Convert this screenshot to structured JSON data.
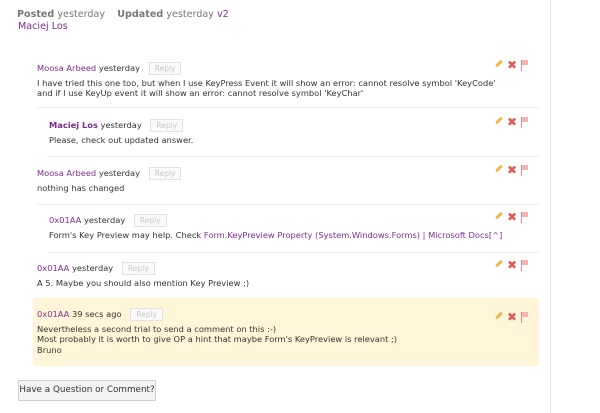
{
  "header": {
    "posted_label": "Posted",
    "posted_time": "yesterday",
    "updated_label": "Updated",
    "updated_time": "yesterday",
    "version": "v2",
    "author": "Maciej Los"
  },
  "comments": [
    {
      "author": "Moosa Arbeed",
      "time": "yesterday",
      "reply": "Reply",
      "lines": [
        "I have tried this one too, but when I use KeyPress Event it will show an error: cannot resolve symbol 'KeyCode'",
        "and if I use KeyUp event it will show an error: cannot resolve symbol 'KeyChar'"
      ]
    },
    {
      "author": "Maciej Los",
      "time": "yesterday",
      "reply": "Reply",
      "lines": [
        "Please, check out updated answer."
      ]
    },
    {
      "author": "Moosa Arbeed",
      "time": "yesterday",
      "reply": "Reply",
      "lines": [
        "nothing has changed"
      ]
    },
    {
      "author": "0x01AA",
      "time": "yesterday",
      "reply": "Reply",
      "text_before": "Form's Key Preview may help. Check ",
      "link_text": "Form.KeyPreview Property (System.Windows.Forms) | Microsoft Docs",
      "link_suffix": "[^]"
    },
    {
      "author": "0x01AA",
      "time": "yesterday",
      "reply": "Reply",
      "lines": [
        "A 5. Maybe you should also mention Key Preview ;)"
      ]
    },
    {
      "author": "0x01AA",
      "time": "39 secs ago",
      "reply": "Reply",
      "lines": [
        "Nevertheless a second trial to send a comment on this :-)",
        "Most probably it is worth to give OP a hint that maybe Form's KeyPreview is relevant ;)",
        "Bruno"
      ]
    }
  ],
  "ask_button": "Have a Question or Comment?"
}
